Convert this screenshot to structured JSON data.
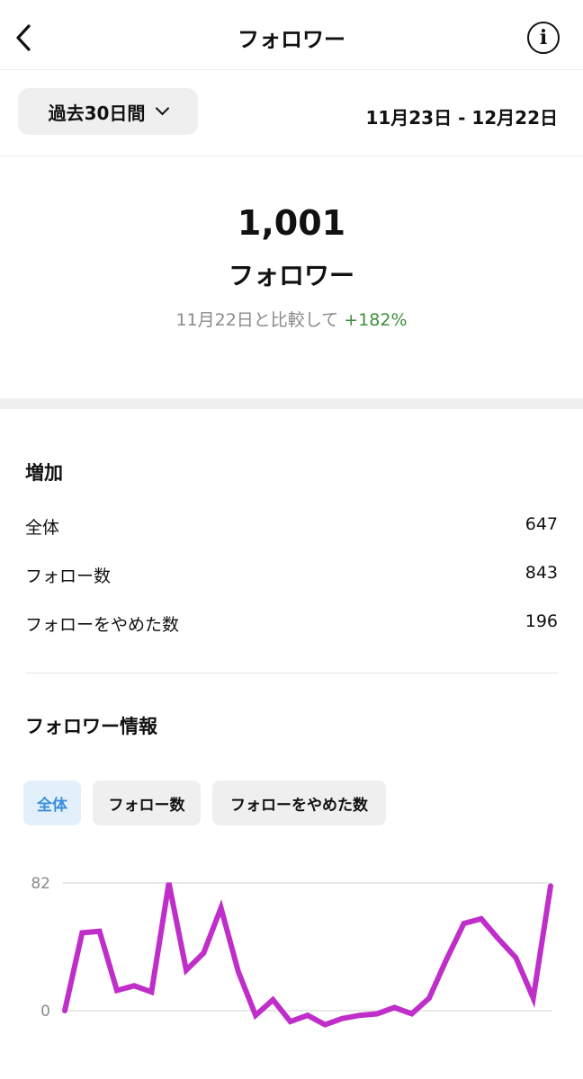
{
  "header": {
    "title": "フォロワー",
    "back_icon": "chevron-left-icon",
    "info_icon": "info-icon",
    "info_glyph": "i"
  },
  "filter": {
    "period_label": "過去30日間",
    "date_range": "11月23日 - 12月22日"
  },
  "summary": {
    "total": "1,001",
    "label": "フォロワー",
    "compare_text": "11月22日と比較して",
    "compare_change": "+182%"
  },
  "growth": {
    "title": "増加",
    "rows": [
      {
        "label": "全体",
        "value": "647"
      },
      {
        "label": "フォロー数",
        "value": "843"
      },
      {
        "label": "フォローをやめた数",
        "value": "196"
      }
    ]
  },
  "info": {
    "title": "フォロワー情報",
    "tabs": [
      {
        "label": "全体",
        "active": true
      },
      {
        "label": "フォロー数",
        "active": false
      },
      {
        "label": "フォローをやめた数",
        "active": false
      }
    ]
  },
  "chart_data": {
    "type": "line",
    "title": "",
    "xlabel": "",
    "ylabel": "",
    "y_ticks": [
      "82",
      "0"
    ],
    "ylim": [
      0,
      82
    ],
    "grid": true,
    "series": [
      {
        "color": "#c02ec9",
        "values": [
          0,
          50,
          51,
          13,
          16,
          12,
          82,
          26,
          37,
          66,
          25,
          -3,
          7,
          -7,
          -3,
          -9,
          -5,
          -3,
          -2,
          2,
          -2,
          8,
          33,
          56,
          59,
          46,
          34,
          8,
          80
        ]
      }
    ]
  }
}
